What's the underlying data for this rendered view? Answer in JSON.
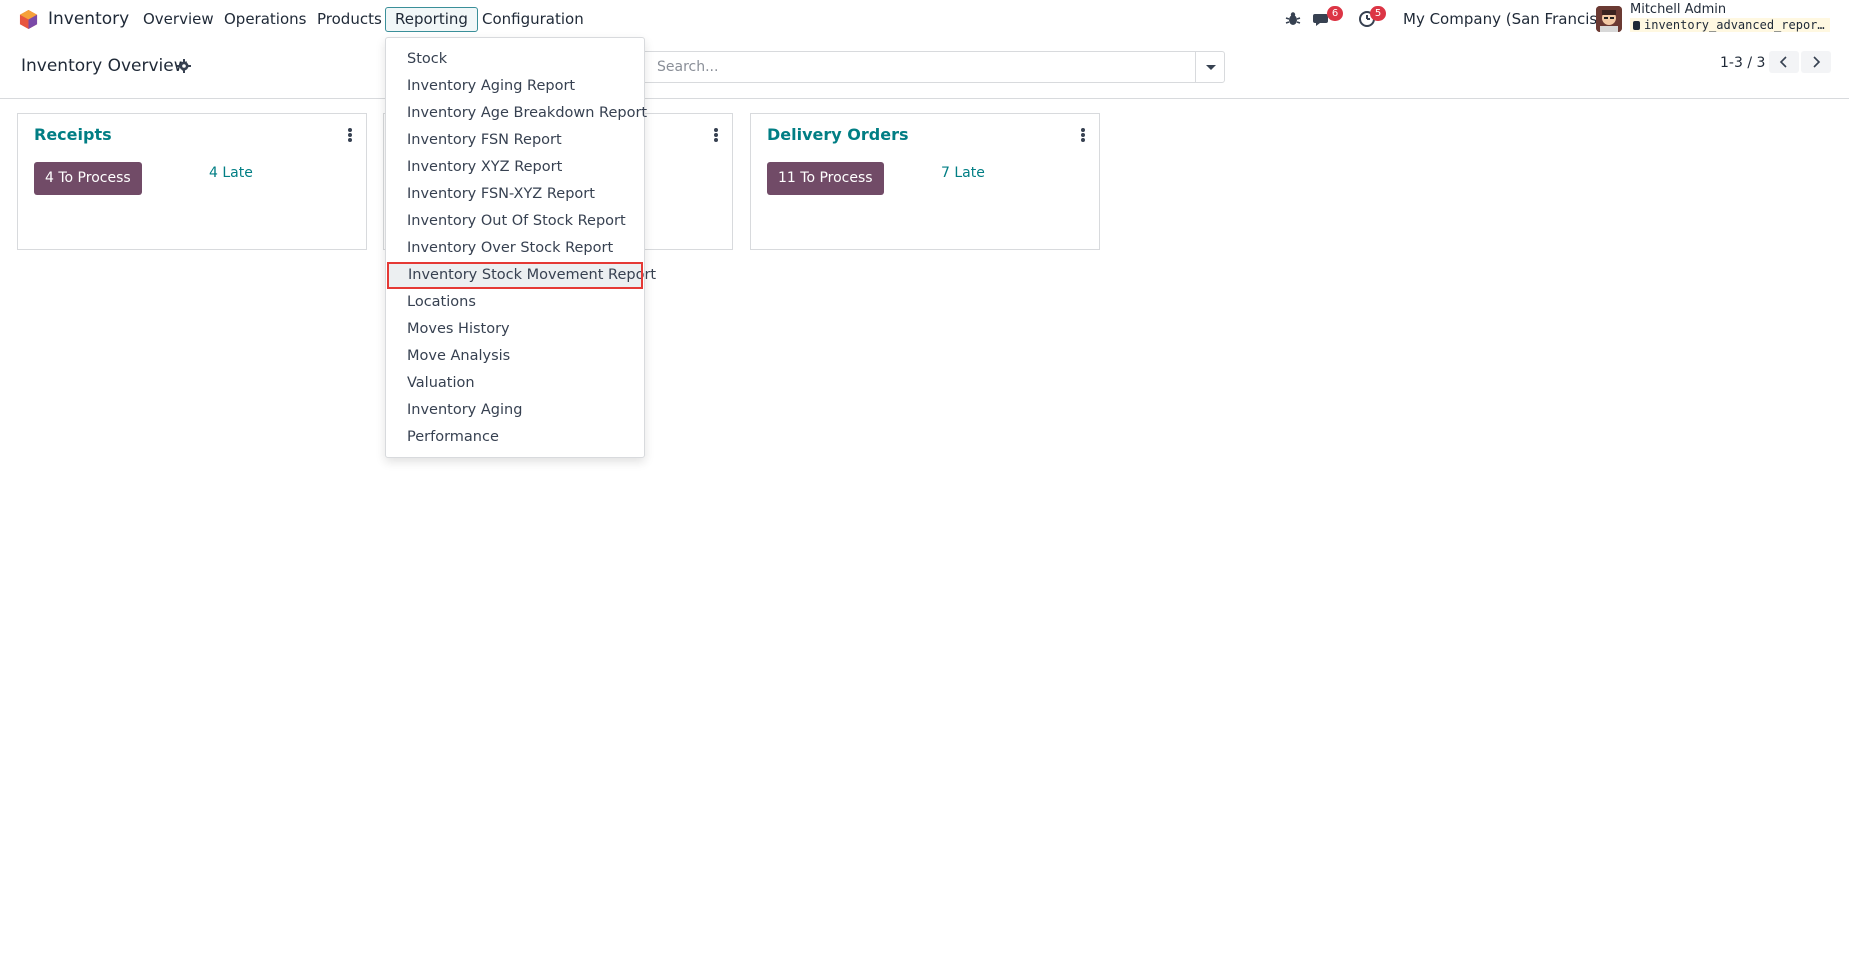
{
  "app": {
    "name": "Inventory",
    "menu": [
      "Overview",
      "Operations",
      "Products",
      "Reporting",
      "Configuration"
    ]
  },
  "systray": {
    "messages_count": "6",
    "activities_count": "5",
    "company": "My Company (San Francisco)",
    "user_name": "Mitchell Admin",
    "database": "inventory_advanced_reports"
  },
  "control_panel": {
    "title": "Inventory Overview",
    "search_placeholder": "Search...",
    "pager": "1-3 / 3"
  },
  "reporting_menu": {
    "items": [
      "Stock",
      "Inventory Aging Report",
      "Inventory Age Breakdown Report",
      "Inventory FSN Report",
      "Inventory XYZ Report",
      "Inventory FSN-XYZ Report",
      "Inventory Out Of Stock Report",
      "Inventory Over Stock Report",
      "Inventory Stock Movement Report",
      "Locations",
      "Moves History",
      "Move Analysis",
      "Valuation",
      "Inventory Aging",
      "Performance"
    ],
    "highlighted": "Inventory Stock Movement Report"
  },
  "cards": [
    {
      "title": "Receipts",
      "process": "4 To Process",
      "late": "4 Late"
    },
    {
      "title": "",
      "process": "",
      "late": ""
    },
    {
      "title": "Delivery Orders",
      "process": "11 To Process",
      "late": "7 Late"
    }
  ],
  "colors": {
    "brand": "#714b67",
    "accent": "#017e84",
    "badge": "#dc3545",
    "highlight_border": "#e53935"
  }
}
